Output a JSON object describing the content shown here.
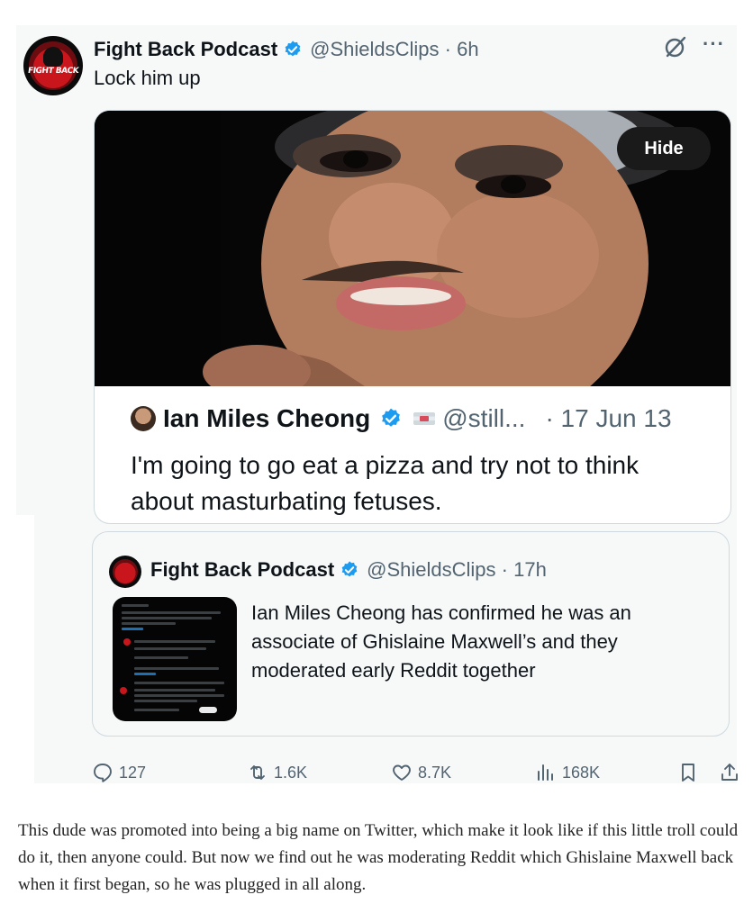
{
  "tweet": {
    "author_name": "Fight Back Podcast",
    "author_handle": "@ShieldsClips",
    "time": "6h",
    "text": "Lock him up",
    "avatar_text": "FIGHT BACK",
    "hide_label": "Hide",
    "embedded": {
      "author_name": "Ian Miles Cheong",
      "author_handle": "@still...",
      "date": "· 17 Jun 13",
      "text": "I'm going to go eat a pizza and try not to think about masturbating fetuses."
    },
    "quote": {
      "author_name": "Fight Back Podcast",
      "author_handle": "@ShieldsClips",
      "time": "17h",
      "text": "Ian Miles Cheong has confirmed he was an associate of Ghislaine Maxwell’s and they moderated early Reddit together"
    },
    "actions": {
      "replies": "127",
      "reposts": "1.6K",
      "likes": "8.7K",
      "views": "168K"
    }
  },
  "article": {
    "paragraph": "This dude was promoted into being a big name on Twitter, which make it look like if this little troll could do it, then anyone could. But now we find out he was moderating Reddit which Ghislaine Maxwell back when it first began, so he was plugged in all along."
  },
  "colors": {
    "accent": "#1d9bf0",
    "text": "#0f1419",
    "muted": "#536471",
    "card_bg": "#f7f9f9",
    "border": "#cfd9de"
  },
  "icons": [
    "verified-badge-icon",
    "grok-icon",
    "more-icon",
    "reply-icon",
    "repost-icon",
    "like-icon",
    "views-icon",
    "bookmark-icon",
    "share-icon",
    "flag-icon"
  ]
}
